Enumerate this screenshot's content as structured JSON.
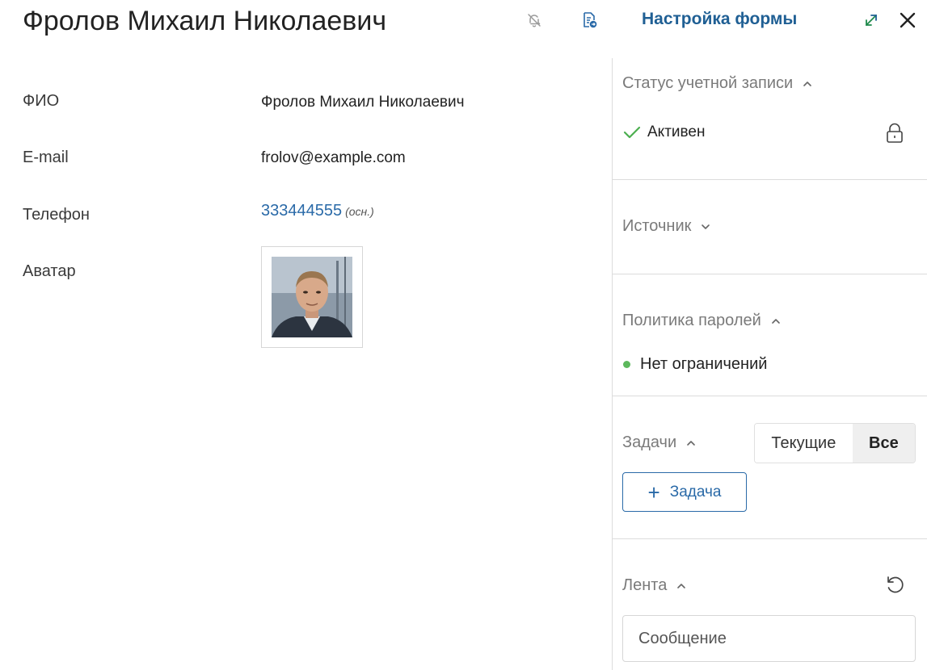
{
  "header": {
    "title": "Фролов Михаил Николаевич",
    "form_settings_label": "Настройка формы",
    "icons": [
      "bell-off-icon",
      "document-export-icon",
      "expand-icon",
      "close-icon"
    ]
  },
  "fields": [
    {
      "label": "ФИО",
      "value": "Фролов Михаил Николаевич"
    },
    {
      "label": "E-mail",
      "value": "frolov@example.com"
    },
    {
      "label": "Телефон",
      "value": "333444555",
      "note": "(осн.)"
    },
    {
      "label": "Аватар"
    }
  ],
  "panel": {
    "account_status": {
      "title": "Статус учетной записи",
      "value": "Активен",
      "icon": "lock-icon"
    },
    "source": {
      "title": "Источник"
    },
    "password_policy": {
      "title": "Политика паролей",
      "value": "Нет ограничений",
      "dot_color": "#5cb85c"
    },
    "tasks": {
      "title": "Задачи",
      "tabs": [
        "Текущие",
        "Все"
      ],
      "selected_tab": "Все",
      "add_label": "Задача"
    },
    "feed": {
      "title": "Лента",
      "message_placeholder": "Сообщение",
      "icon": "refresh-icon"
    }
  },
  "colors": {
    "accent": "#2a6aa8",
    "title_link": "#1f5f94",
    "success": "#5cb85c"
  }
}
